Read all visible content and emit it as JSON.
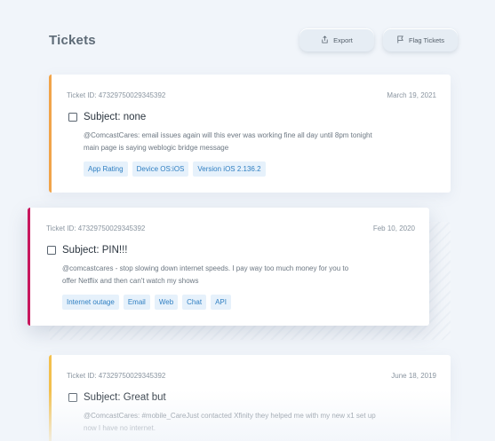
{
  "header": {
    "title": "Tickets",
    "export_label": "Export",
    "flag_label": "Flag Tickets"
  },
  "tickets": [
    {
      "id_text": "Ticket ID: 47329750029345392",
      "date": "March 19, 2021",
      "subject": "Subject: none",
      "body_line1": "@ComcastCares: email issues again will this ever was working fine all day until 8pm tonight",
      "body_line2": "main page is saying weblogic bridge message",
      "tags": [
        "App Rating",
        "Device OS:iOS",
        "Version iOS 2.136.2"
      ],
      "accent": "#f1a44a"
    },
    {
      "id_text": "Ticket ID: 47329750029345392",
      "date": "Feb 10, 2020",
      "subject": "Subject: PIN!!!",
      "body_line1": "@comcastcares - stop slowing down internet speeds. I pay way too much money for you to",
      "body_line2": "offer Netflix and then can't watch my shows",
      "tags": [
        "Internet outage",
        "Email",
        "Web",
        "Chat",
        "API"
      ],
      "accent": "#c8175d"
    },
    {
      "id_text": "Ticket ID: 47329750029345392",
      "date": "June 18, 2019",
      "subject": "Subject: Great but",
      "body_line1": "@ComcastCares: #mobile_CareJust contacted Xfinity they helped me with my new x1 set up",
      "body_line2": "now I have no internet.",
      "tags": [],
      "accent": "#f3c04d"
    }
  ],
  "icons": {
    "export": "export-icon",
    "flag": "flag-icon",
    "checkbox": "checkbox-icon"
  }
}
